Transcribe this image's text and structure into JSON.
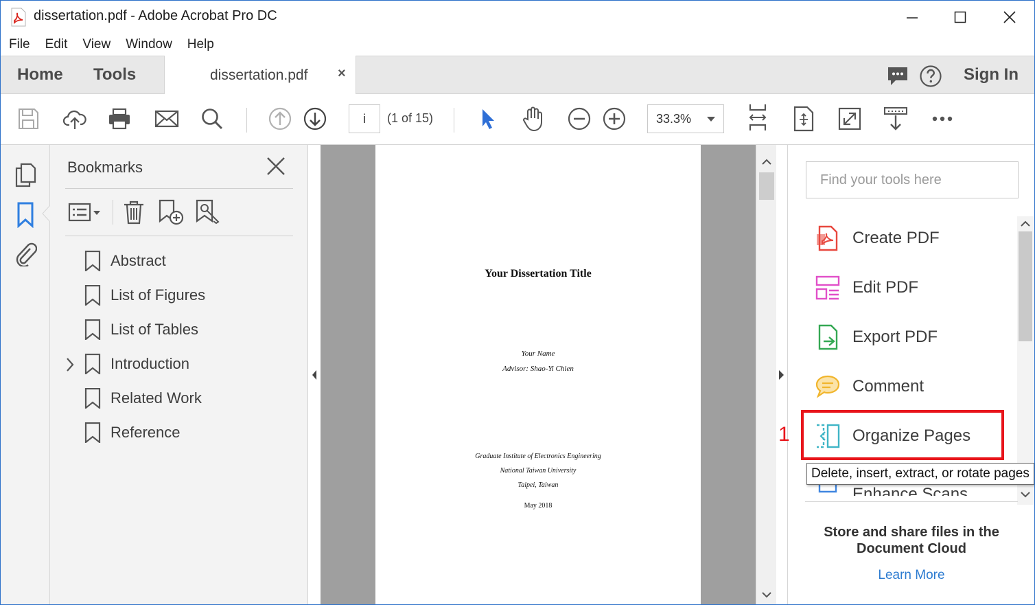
{
  "window": {
    "title": "dissertation.pdf - Adobe Acrobat Pro DC"
  },
  "menu": [
    "File",
    "Edit",
    "View",
    "Window",
    "Help"
  ],
  "tabs": {
    "home": "Home",
    "tools": "Tools",
    "document": "dissertation.pdf",
    "close_glyph": "×",
    "sign_in": "Sign In"
  },
  "toolbar": {
    "page_input": "i",
    "page_of": "(1 of 15)",
    "zoom": "33.3%",
    "icons": [
      "save-icon",
      "cloud-upload-icon",
      "print-icon",
      "mail-icon",
      "search-icon",
      "page-up-icon",
      "page-down-icon",
      "select-arrow-icon",
      "hand-icon",
      "zoom-out-icon",
      "zoom-in-icon",
      "fit-page-icon",
      "scroll-mode-icon",
      "fullscreen-icon",
      "read-mode-icon",
      "more-icon"
    ]
  },
  "bookmarks": {
    "title": "Bookmarks",
    "items": [
      {
        "label": "Abstract",
        "expandable": false
      },
      {
        "label": "List of Figures",
        "expandable": false
      },
      {
        "label": "List of Tables",
        "expandable": false
      },
      {
        "label": "Introduction",
        "expandable": true
      },
      {
        "label": "Related Work",
        "expandable": false
      },
      {
        "label": "Reference",
        "expandable": false
      }
    ]
  },
  "document": {
    "title": "Your Dissertation Title",
    "name": "Your Name",
    "advisor": "Advisor: Shao-Yi Chien",
    "institute": "Graduate Institute of Electronics Engineering",
    "university": "National Taiwan University",
    "location": "Taipei, Taiwan",
    "date": "May 2018"
  },
  "tools_pane": {
    "search_placeholder": "Find your tools here",
    "tools": [
      {
        "label": "Create PDF",
        "color": "#e8483f"
      },
      {
        "label": "Edit PDF",
        "color": "#e14fc9"
      },
      {
        "label": "Export PDF",
        "color": "#34a853"
      },
      {
        "label": "Comment",
        "color": "#f1b52c"
      },
      {
        "label": "Organize Pages",
        "color": "#3fb5c6"
      },
      {
        "label": "Enhance Scans",
        "color": "#3f86e0"
      }
    ],
    "tooltip": "Delete, insert, extract, or rotate pages",
    "step_marker": "1",
    "promo": "Store and share files in the Document Cloud",
    "learn_more": "Learn More"
  },
  "colors": {
    "accent_blue": "#2f7fe0",
    "highlight_red": "#e8151b",
    "link": "#2c7bd0"
  }
}
